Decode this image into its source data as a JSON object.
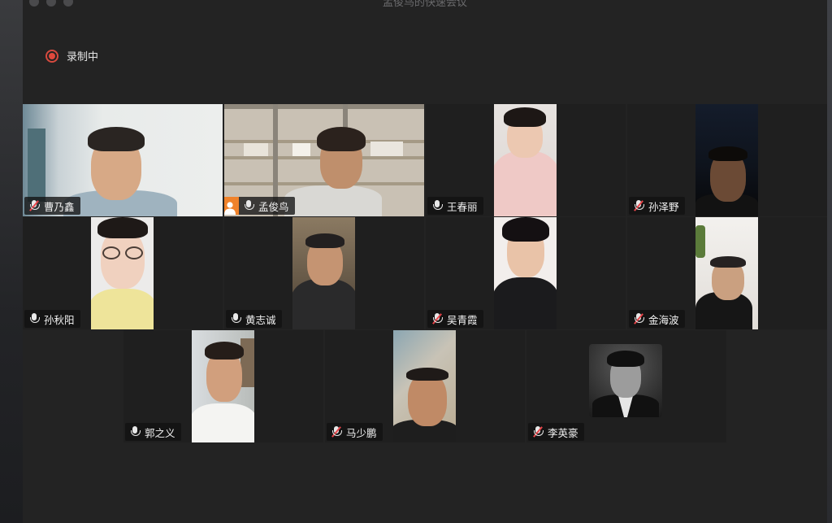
{
  "window": {
    "title": "孟俊鸟的快速会议"
  },
  "recording": {
    "label": "录制中"
  },
  "participants": [
    {
      "name": "曹乃鑫",
      "muted": true
    },
    {
      "name": "孟俊鸟",
      "muted": false,
      "host": true,
      "active_speaker": true
    },
    {
      "name": "王春丽",
      "muted": false
    },
    {
      "name": "孙泽野",
      "muted": true
    },
    {
      "name": "孙秋阳",
      "muted": false
    },
    {
      "name": "黄志诚",
      "muted": false
    },
    {
      "name": "吴青霞",
      "muted": true
    },
    {
      "name": "金海波",
      "muted": true
    },
    {
      "name": "郭之义",
      "muted": false
    },
    {
      "name": "马少鹏",
      "muted": true
    },
    {
      "name": "李英豪",
      "muted": true
    }
  ],
  "colors": {
    "active_border": "#23b24b",
    "recording": "#e0483c",
    "host_badge": "#f0822a"
  }
}
